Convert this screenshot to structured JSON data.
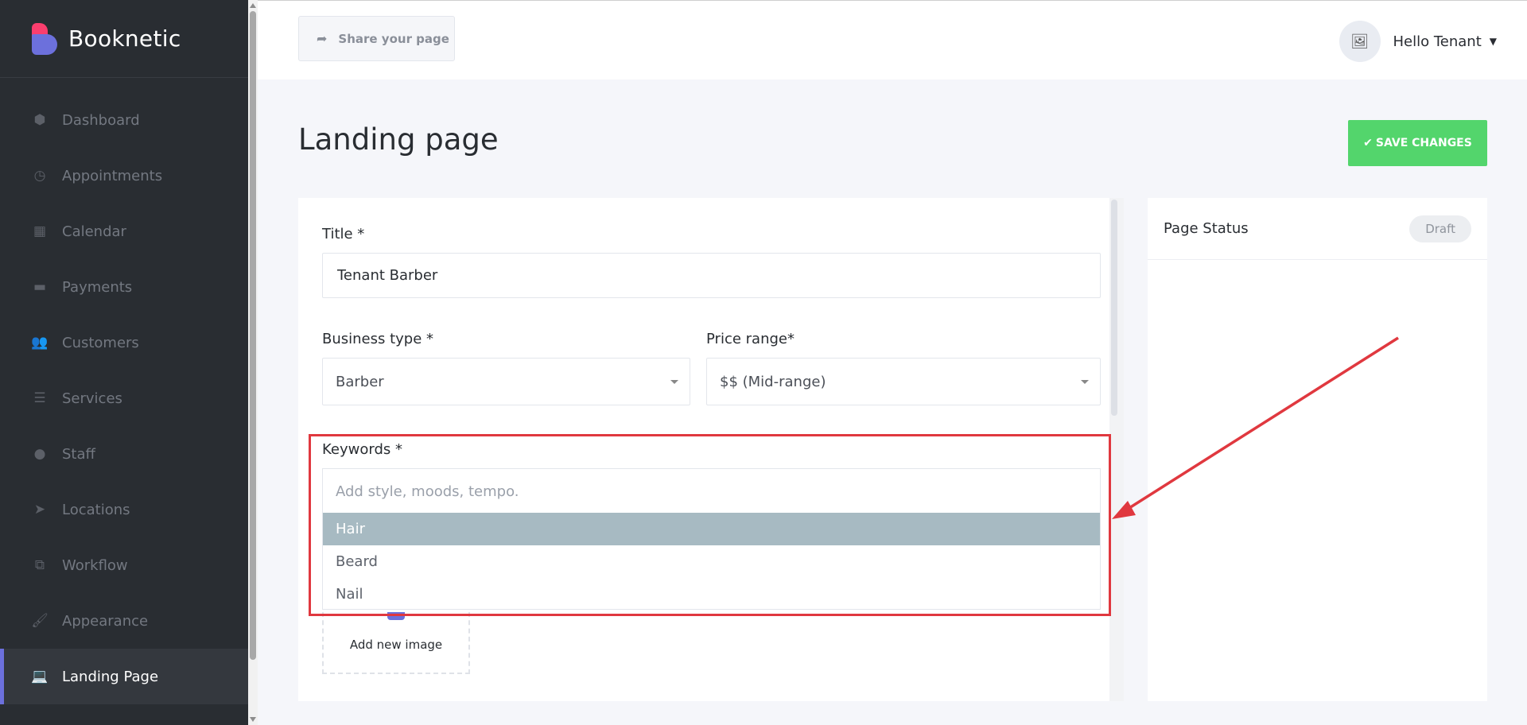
{
  "brand": {
    "name": "Booknetic"
  },
  "sidebar": {
    "items": [
      {
        "label": "Dashboard",
        "icon": "cube-icon",
        "glyph": "⬢"
      },
      {
        "label": "Appointments",
        "icon": "clock-icon",
        "glyph": "◷"
      },
      {
        "label": "Calendar",
        "icon": "calendar-icon",
        "glyph": "▦"
      },
      {
        "label": "Payments",
        "icon": "wallet-icon",
        "glyph": "▬"
      },
      {
        "label": "Customers",
        "icon": "users-icon",
        "glyph": "👥"
      },
      {
        "label": "Services",
        "icon": "list-icon",
        "glyph": "☰"
      },
      {
        "label": "Staff",
        "icon": "user-icon",
        "glyph": "●"
      },
      {
        "label": "Locations",
        "icon": "location-arrow-icon",
        "glyph": "➤"
      },
      {
        "label": "Workflow",
        "icon": "workflow-icon",
        "glyph": "⧉"
      },
      {
        "label": "Appearance",
        "icon": "brush-icon",
        "glyph": "🖌"
      },
      {
        "label": "Landing Page",
        "icon": "laptop-icon",
        "glyph": "💻"
      }
    ],
    "active": "Landing Page"
  },
  "header": {
    "share_label": "Share your page",
    "user_greeting": "Hello Tenant"
  },
  "page": {
    "title": "Landing page",
    "save_label": "SAVE CHANGES"
  },
  "form": {
    "title_label": "Title *",
    "title_value": "Tenant Barber",
    "business_type_label": "Business type *",
    "business_type_value": "Barber",
    "price_range_label": "Price range*",
    "price_range_value": "$$ (Mid-range)",
    "keywords_label": "Keywords *",
    "keywords_placeholder": "Add style, moods, tempo.",
    "keyword_options": [
      "Hair",
      "Beard",
      "Nail"
    ],
    "keyword_selected": "Hair",
    "add_image_label": "Add new image"
  },
  "status_card": {
    "title": "Page Status",
    "badge": "Draft"
  },
  "colors": {
    "accent": "#6c70dc",
    "save": "#53d56c",
    "highlight": "#e0383f",
    "selected_option": "#a7bac2"
  }
}
